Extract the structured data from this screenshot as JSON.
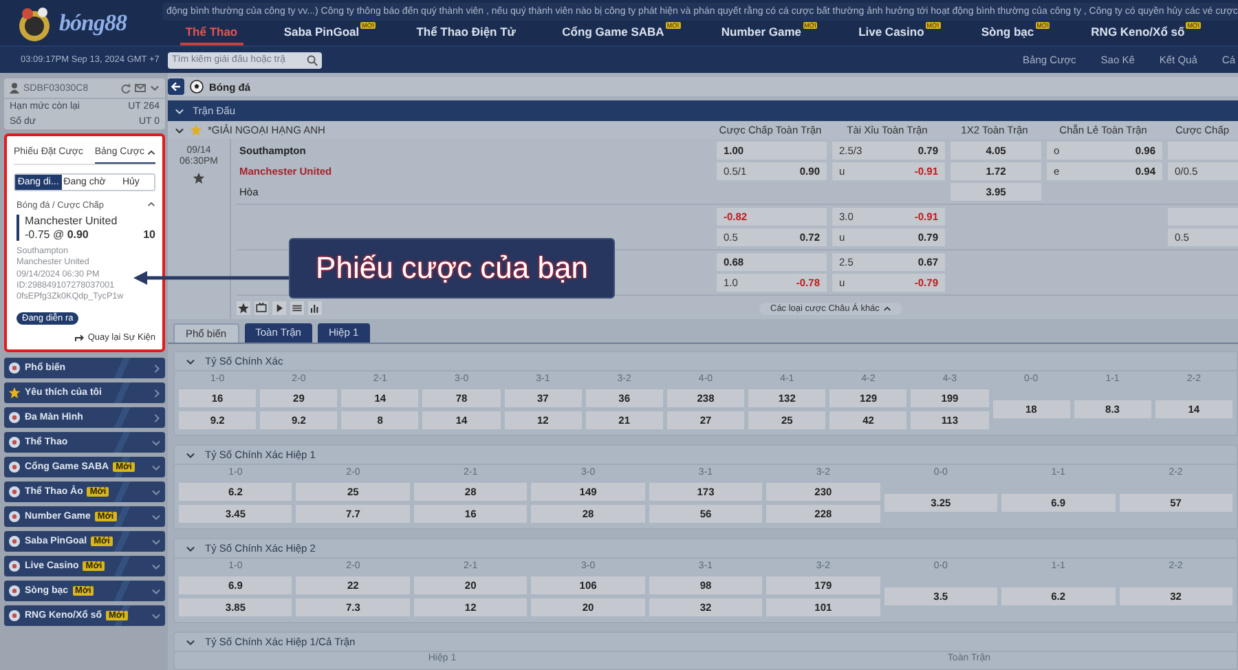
{
  "header": {
    "logo_text": "bóng88",
    "ticker": "động bình thường của công ty vv...) Công ty thông báo đến quý thành viên , nếu quý thành viên nào bị công ty phát hiện và phán quyết rằng có cá cược bất thường ảnh hưởng tới hoạt động bình thường của công ty , Công ty có quyền hủy các vé cược",
    "nav": [
      {
        "label": "Thể Thao",
        "selected": true
      },
      {
        "label": "Saba PinGoal",
        "selected": false,
        "badge": "MỚI"
      },
      {
        "label": "Thể Thao Điện Tử",
        "selected": false
      },
      {
        "label": "Cổng Game SABA",
        "selected": false,
        "badge": "MỚI"
      },
      {
        "label": "Number Game",
        "selected": false,
        "badge": "MỚI"
      },
      {
        "label": "Live Casino",
        "selected": false,
        "badge": "MỚI"
      },
      {
        "label": "Sòng bạc",
        "selected": false,
        "badge": "MỚI"
      },
      {
        "label": "RNG Keno/Xổ số",
        "selected": false,
        "badge": "MỚI"
      }
    ],
    "clock": "03:09:17PM Sep 13, 2024 GMT +7",
    "search": {
      "placeholder": "Tìm kiếm giải đấu hoặc trậ"
    },
    "links": [
      "Bảng Cược",
      "Sao Kê",
      "Kết Quả",
      "Cá"
    ]
  },
  "account": {
    "username": "SDBF03030C8",
    "rows": [
      {
        "label": "Hạn mức còn lại",
        "value": "UT 264"
      },
      {
        "label": "Số dư",
        "value": "UT 0"
      }
    ]
  },
  "bet_slip": {
    "tabs": [
      {
        "label": "Phiếu Đặt Cược",
        "selected": false
      },
      {
        "label": "Bảng Cược",
        "selected": true
      }
    ],
    "filters": [
      {
        "label": "Đang di...",
        "selected": true
      },
      {
        "label": "Đang chờ",
        "selected": false
      },
      {
        "label": "Hủy",
        "selected": false
      }
    ],
    "bet": {
      "market": "Bóng đá / Cược Chấp",
      "selection": "Manchester United",
      "line": "-0.75 @",
      "odds": "0.90",
      "stake": "10",
      "details": [
        "Southampton",
        "Manchester United",
        "09/14/2024 06:30 PM",
        "ID:298849107278037001",
        "0fsEPfg3Zk0KQdp_TycP1w"
      ],
      "status": "Đang diễn ra"
    },
    "back_link": "Quay lại Sự Kiện"
  },
  "menu": [
    {
      "label": "Phổ biến",
      "kind": "link"
    },
    {
      "label": "Yêu thích của tôi",
      "kind": "link"
    },
    {
      "label": "Đa Màn Hình",
      "kind": "link"
    },
    {
      "label": "Thể Thao",
      "kind": "group"
    },
    {
      "label": "Cổng Game SABA",
      "kind": "group",
      "badge": "Mới"
    },
    {
      "label": "Thể Thao Ảo",
      "kind": "group",
      "badge": "Mới"
    },
    {
      "label": "Number Game",
      "kind": "group",
      "badge": "Mới"
    },
    {
      "label": "Saba PinGoal",
      "kind": "group",
      "badge": "Mới"
    },
    {
      "label": "Live Casino",
      "kind": "group",
      "badge": "Mới"
    },
    {
      "label": "Sòng bạc",
      "kind": "group",
      "badge": "Mới"
    },
    {
      "label": "RNG Keno/Xổ số",
      "kind": "group",
      "badge": "Mới"
    }
  ],
  "breadcrumb": "Bóng đá",
  "section_title": "Trận Đấu",
  "league": {
    "name": "*GIẢI NGOẠI HẠNG ANH",
    "columns": [
      "Cược Chấp Toàn Trận",
      "Tài Xỉu Toàn Trận",
      "1X2 Toàn Trận",
      "Chẵn Lẻ Toàn Trận",
      "Cược Chấp"
    ]
  },
  "match": {
    "date": "09/14",
    "time": "06:30PM",
    "home": "Southampton",
    "away": "Manchester United",
    "draw": "Hòa",
    "lines": [
      {
        "handicap": [
          {
            "value": "1.00",
            "negative": false
          },
          {
            "label": "0.5/1",
            "value": "0.90",
            "negative": false
          }
        ],
        "over_under": [
          {
            "label": "2.5/3",
            "value": "0.79",
            "negative": false
          },
          {
            "label": "u",
            "value": "-0.91",
            "negative": true
          }
        ],
        "one_x_two": [
          {
            "value": "4.05",
            "negative": false
          },
          {
            "value": "1.72",
            "negative": false
          },
          {
            "value": "3.95",
            "negative": false
          }
        ],
        "odd_even": [
          {
            "label": "o",
            "value": "0.96",
            "negative": false
          },
          {
            "label": "e",
            "value": "0.94",
            "negative": false
          }
        ],
        "column_5": [
          {
            "kind": "empty"
          },
          {
            "kind": "line",
            "label": "0/0.5"
          }
        ]
      },
      {
        "handicap": [
          {
            "value": "-0.82",
            "negative": true
          },
          {
            "label": "0.5",
            "value": "0.72",
            "negative": false
          }
        ],
        "over_under": [
          {
            "label": "3.0",
            "value": "-0.91",
            "negative": true
          },
          {
            "label": "u",
            "value": "0.79",
            "negative": false
          }
        ],
        "column_5": [
          {
            "kind": "empty"
          },
          {
            "kind": "line",
            "label": "0.5"
          }
        ]
      },
      {
        "handicap": [
          {
            "value": "0.68",
            "negative": false
          },
          {
            "label": "1.0",
            "value": "-0.78",
            "negative": true
          }
        ],
        "over_under": [
          {
            "label": "2.5",
            "value": "0.67",
            "negative": false
          },
          {
            "label": "u",
            "value": "-0.79",
            "negative": true
          }
        ]
      }
    ],
    "more_bets": "Các loại cược Châu Á khác"
  },
  "market_tabs": [
    {
      "label": "Phổ biến",
      "selected": true
    },
    {
      "label": "Toàn Trận",
      "selected": false
    },
    {
      "label": "Hiệp 1",
      "selected": false
    }
  ],
  "score_sections": [
    {
      "kind": "grid",
      "title": "Tỷ Số Chính Xác",
      "scores": [
        {
          "score": "1-0",
          "home": "16",
          "away": "9.2"
        },
        {
          "score": "2-0",
          "home": "29",
          "away": "9.2"
        },
        {
          "score": "2-1",
          "home": "14",
          "away": "8"
        },
        {
          "score": "3-0",
          "home": "78",
          "away": "14"
        },
        {
          "score": "3-1",
          "home": "37",
          "away": "12"
        },
        {
          "score": "3-2",
          "home": "36",
          "away": "21"
        },
        {
          "score": "4-0",
          "home": "238",
          "away": "27"
        },
        {
          "score": "4-1",
          "home": "132",
          "away": "25"
        },
        {
          "score": "4-2",
          "home": "129",
          "away": "42"
        },
        {
          "score": "4-3",
          "home": "199",
          "away": "113"
        }
      ],
      "draws": [
        {
          "score": "0-0",
          "value": "18"
        },
        {
          "score": "1-1",
          "value": "8.3"
        },
        {
          "score": "2-2",
          "value": "14"
        }
      ]
    },
    {
      "kind": "grid",
      "title": "Tỷ Số Chính Xác Hiệp 1",
      "scores": [
        {
          "score": "1-0",
          "home": "6.2",
          "away": "3.45"
        },
        {
          "score": "2-0",
          "home": "25",
          "away": "7.7"
        },
        {
          "score": "2-1",
          "home": "28",
          "away": "16"
        },
        {
          "score": "3-0",
          "home": "149",
          "away": "28"
        },
        {
          "score": "3-1",
          "home": "173",
          "away": "56"
        },
        {
          "score": "3-2",
          "home": "230",
          "away": "228"
        }
      ],
      "draws": [
        {
          "score": "0-0",
          "value": "3.25"
        },
        {
          "score": "1-1",
          "value": "6.9"
        },
        {
          "score": "2-2",
          "value": "57"
        }
      ]
    },
    {
      "kind": "grid",
      "title": "Tỷ Số Chính Xác Hiệp 2",
      "scores": [
        {
          "score": "1-0",
          "home": "6.9",
          "away": "3.85"
        },
        {
          "score": "2-0",
          "home": "22",
          "away": "7.3"
        },
        {
          "score": "2-1",
          "home": "20",
          "away": "12"
        },
        {
          "score": "3-0",
          "home": "106",
          "away": "20"
        },
        {
          "score": "3-1",
          "home": "98",
          "away": "32"
        },
        {
          "score": "3-2",
          "home": "179",
          "away": "101"
        }
      ],
      "draws": [
        {
          "score": "0-0",
          "value": "3.5"
        },
        {
          "score": "1-1",
          "value": "6.2"
        },
        {
          "score": "2-2",
          "value": "32"
        }
      ]
    },
    {
      "kind": "halves",
      "title": "Tỷ Số Chính Xác Hiệp 1/Cả Trận",
      "columns": [
        "Hiệp 1",
        "Toàn Trận"
      ]
    }
  ],
  "callout": {
    "text": "Phiếu cược của bạn"
  }
}
